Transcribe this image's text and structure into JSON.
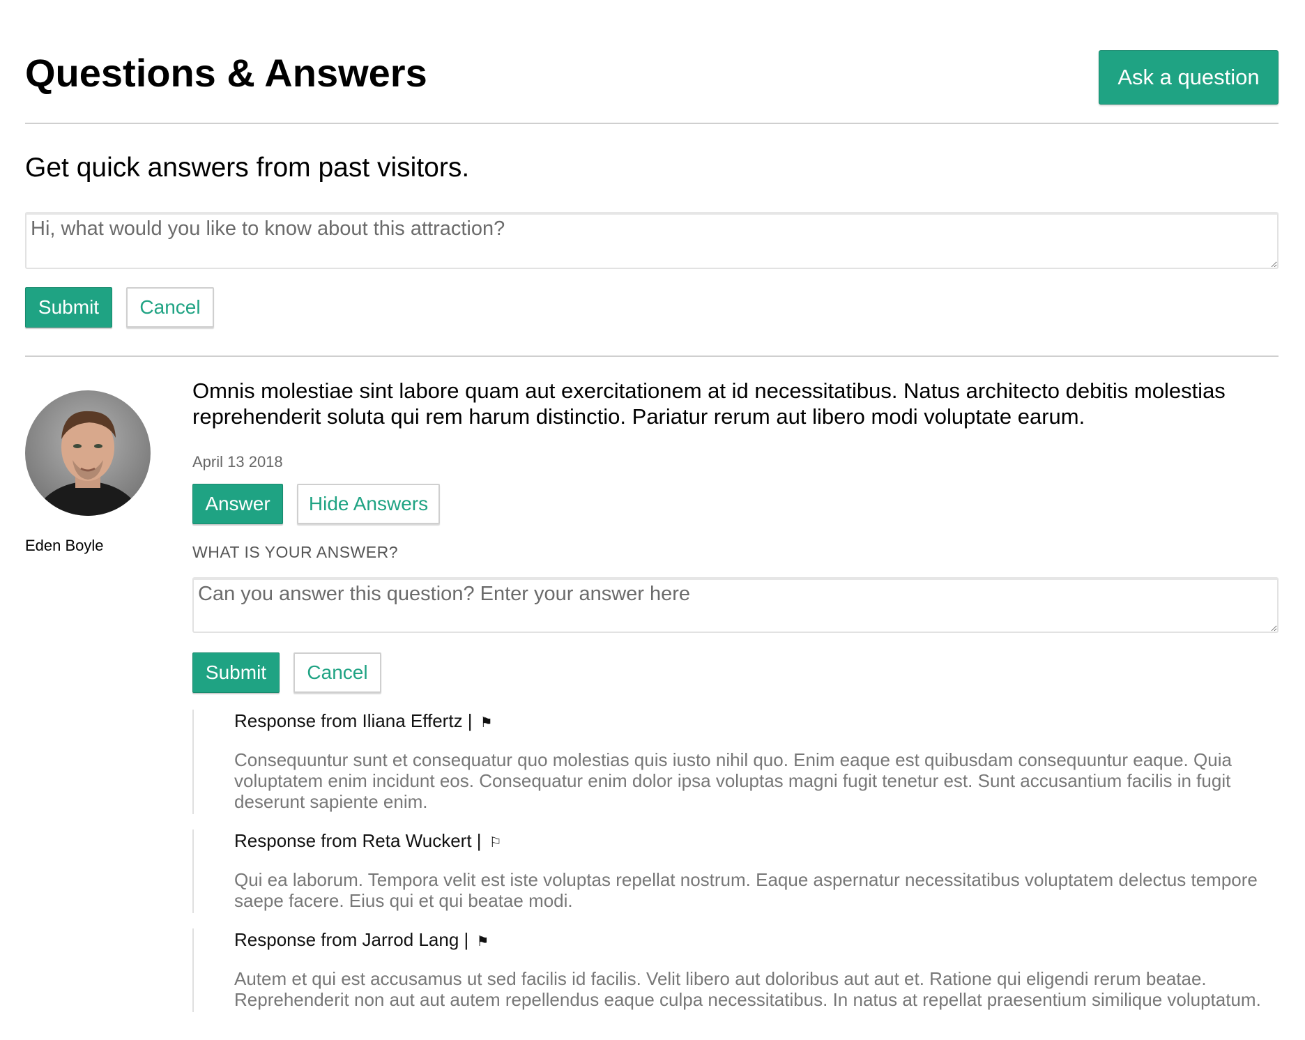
{
  "header": {
    "title": "Questions & Answers",
    "ask_button": "Ask a question"
  },
  "new_question": {
    "subtitle": "Get quick answers from past visitors.",
    "placeholder": "Hi, what would you like to know about this attraction?",
    "submit": "Submit",
    "cancel": "Cancel"
  },
  "question": {
    "author": "Eden Boyle",
    "avatar_icon": "user-photo",
    "text": "Omnis molestiae sint labore quam aut exercitationem at id necessitatibus. Natus architecto debitis molestias reprehenderit soluta qui rem harum distinctio. Pariatur rerum aut libero modi voluptate earum.",
    "date": "April 13 2018",
    "answer_button": "Answer",
    "hide_answers_button": "Hide Answers",
    "answer_prompt": "WHAT IS YOUR ANSWER?",
    "answer_placeholder": "Can you answer this question? Enter your answer here",
    "submit": "Submit",
    "cancel": "Cancel"
  },
  "responses": [
    {
      "heading": "Response from Iliana Effertz |",
      "flag": "⚑",
      "flag_icon": "flag-filled-icon",
      "body": "Consequuntur sunt et consequatur quo molestias quis iusto nihil quo. Enim eaque est quibusdam consequuntur eaque. Quia voluptatem enim incidunt eos. Consequatur enim dolor ipsa voluptas magni fugit tenetur est. Sunt accusantium facilis in fugit deserunt sapiente enim."
    },
    {
      "heading": "Response from Reta Wuckert |",
      "flag": "⚐",
      "flag_icon": "flag-outline-icon",
      "body": "Qui ea laborum. Tempora velit est iste voluptas repellat nostrum. Eaque aspernatur necessitatibus voluptatem delectus tempore saepe facere. Eius qui et qui beatae modi."
    },
    {
      "heading": "Response from Jarrod Lang |",
      "flag": "⚑",
      "flag_icon": "flag-filled-icon",
      "body": "Autem et qui est accusamus ut sed facilis id facilis. Velit libero aut doloribus aut aut et. Ratione qui eligendi rerum beatae. Reprehenderit non aut aut autem repellendus eaque culpa necessitatibus. In natus at repellat praesentium similique voluptatum."
    }
  ],
  "colors": {
    "accent": "#1fa383",
    "divider": "#cfcfcf",
    "muted_text": "#777777"
  }
}
